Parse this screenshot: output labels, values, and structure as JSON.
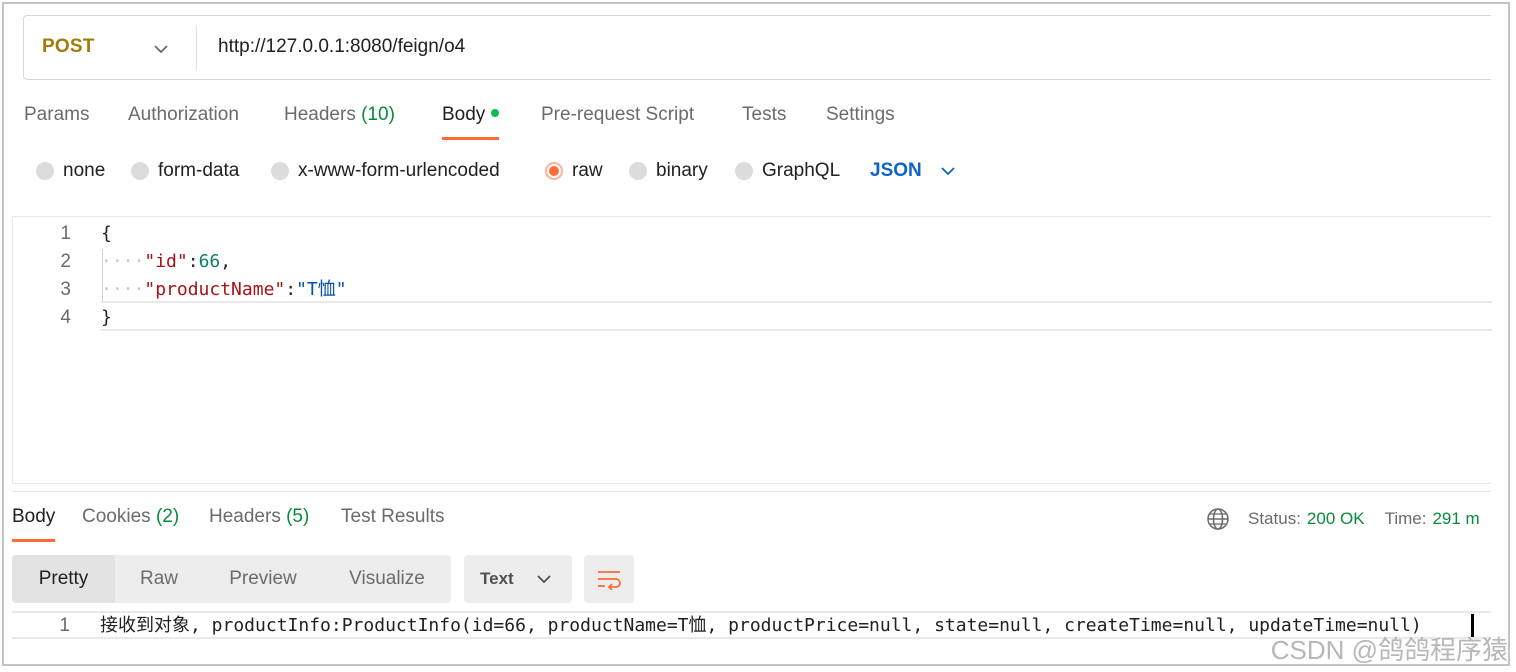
{
  "request": {
    "method": "POST",
    "url": "http://127.0.0.1:8080/feign/o4"
  },
  "request_tabs": {
    "params": "Params",
    "authorization": "Authorization",
    "headers": "Headers",
    "headers_count": "(10)",
    "body": "Body",
    "pre_request": "Pre-request Script",
    "tests": "Tests",
    "settings": "Settings"
  },
  "body_types": {
    "none": "none",
    "form_data": "form-data",
    "urlencoded": "x-www-form-urlencoded",
    "raw": "raw",
    "binary": "binary",
    "graphql": "GraphQL",
    "format": "JSON",
    "selected": "raw"
  },
  "editor": {
    "line_numbers": [
      "1",
      "2",
      "3",
      "4"
    ],
    "open_brace": "{",
    "indent": "····",
    "key_id": "\"id\"",
    "colon": ":",
    "value_id": "66",
    "comma": ",",
    "key_product_name": "\"productName\"",
    "value_product_name": "\"T恤\"",
    "close_brace": "}"
  },
  "response_tabs": {
    "body": "Body",
    "cookies": "Cookies",
    "cookies_count": "(2)",
    "headers": "Headers",
    "headers_count": "(5)",
    "test_results": "Test Results"
  },
  "status": {
    "status_label": "Status:",
    "status_value": "200 OK",
    "time_label": "Time:",
    "time_value": "291 m"
  },
  "view_modes": {
    "pretty": "Pretty",
    "raw": "Raw",
    "preview": "Preview",
    "visualize": "Visualize",
    "format": "Text"
  },
  "response_body": {
    "line_number": "1",
    "text": "接收到对象, productInfo:ProductInfo(id=66, productName=T恤, productPrice=null, state=null, createTime=null, updateTime=null)"
  },
  "watermark": "CSDN @鸽鸽程序猿",
  "colors": {
    "accent": "#ff6c37",
    "method": "#a57a0c",
    "status_ok": "#0a8a3e",
    "json_link": "#0d64c8"
  },
  "icons": {
    "method_dropdown": "chevron-down-icon",
    "format_dropdown": "chevron-down-icon",
    "globe": "globe-icon",
    "wrap": "wrap-lines-icon"
  }
}
